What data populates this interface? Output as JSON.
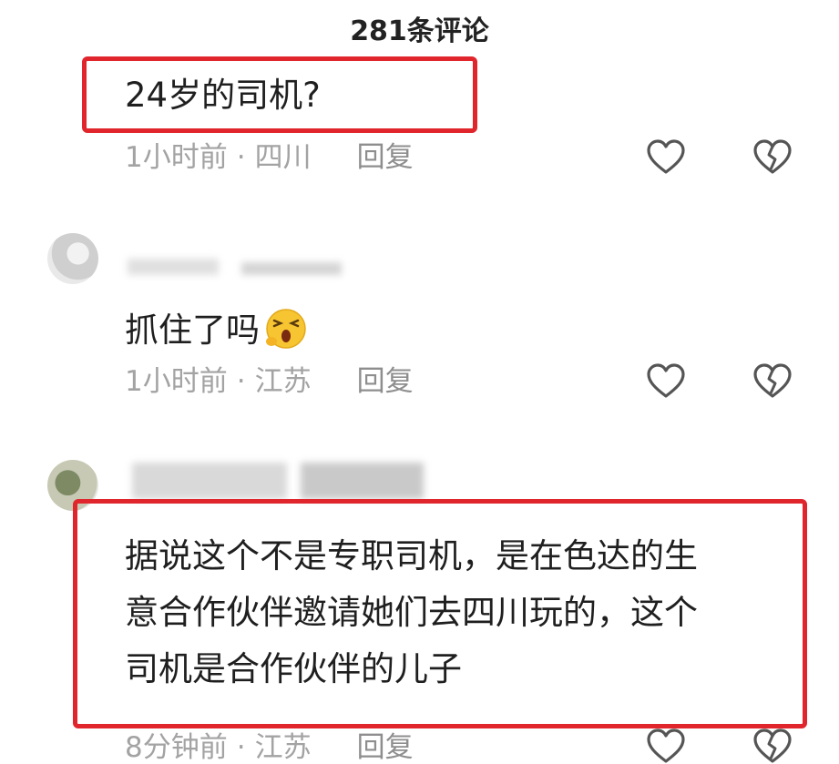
{
  "header": {
    "title": "281条评论"
  },
  "comments": [
    {
      "text": "24岁的司机?",
      "time": "1小时前",
      "separator": "·",
      "location": "四川",
      "reply_label": "回复"
    },
    {
      "text": "抓住了吗",
      "emoji": "scream-emoji-icon",
      "time": "1小时前",
      "separator": "·",
      "location": "江苏",
      "reply_label": "回复"
    },
    {
      "lines": [
        "据说这个不是专职司机，是在色达的生",
        "意合作伙伴邀请她们去四川玩的，这个",
        "司机是合作伙伴的儿子"
      ],
      "time": "8分钟前",
      "separator": "·",
      "location": "江苏",
      "reply_label": "回复"
    }
  ],
  "colors": {
    "highlight_box": "#e0262c",
    "meta_text": "#a3a3a3",
    "icon_stroke": "#555555"
  },
  "icons": [
    "heart-icon",
    "broken-heart-icon"
  ]
}
